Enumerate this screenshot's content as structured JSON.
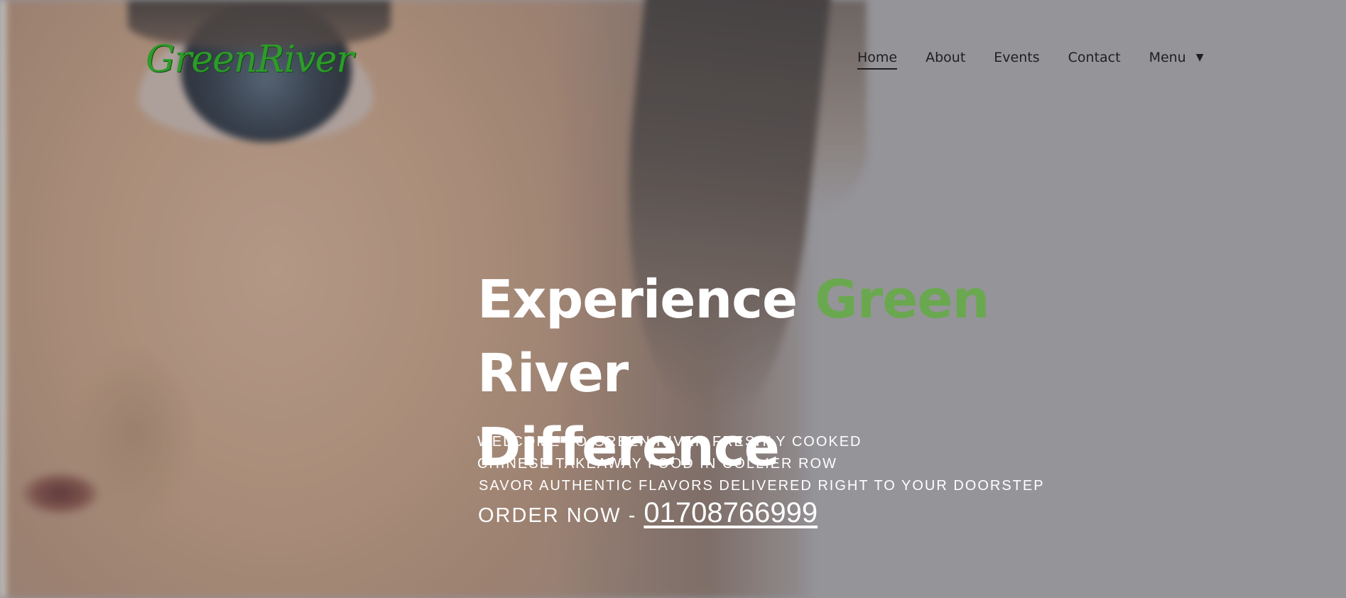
{
  "brand": {
    "logo_text": "GreenRiver",
    "accent_color": "#6aa84f",
    "logo_color": "#2e9b2a"
  },
  "nav": {
    "items": [
      {
        "label": "Home",
        "active": true
      },
      {
        "label": "About"
      },
      {
        "label": "Events"
      },
      {
        "label": "Contact"
      },
      {
        "label": "Menu",
        "has_dropdown": true
      }
    ],
    "dropdown_icon": "caret-down-icon"
  },
  "hero": {
    "headline_part1": "Experience ",
    "headline_highlight": "Green",
    "headline_part2": " River",
    "headline_line2": "Difference",
    "tagline_line1": "WELCOME TO GREEN RIVER FRESHLY COOKED",
    "tagline_line2": "CHINESE TAKEAWAY FOOD IN COLLIER ROW",
    "tagline_line3": "SAVOR AUTHENTIC FLAVORS DELIVERED RIGHT TO YOUR DOORSTEP",
    "order_label": "ORDER NOW - ",
    "phone": "01708766999"
  }
}
